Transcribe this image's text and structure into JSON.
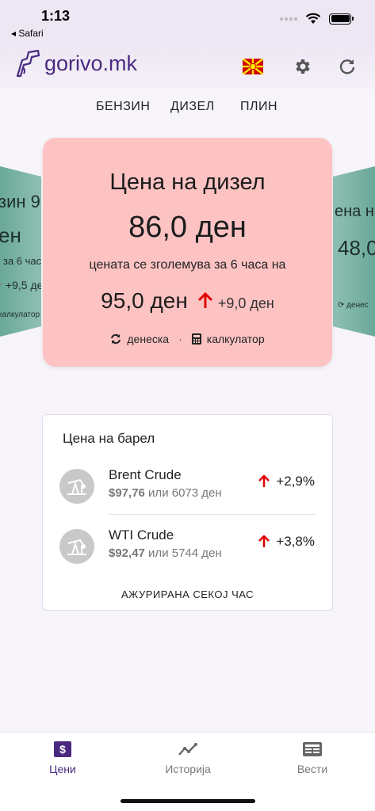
{
  "status": {
    "time": "1:13",
    "back_app": "◂ Safari"
  },
  "header": {
    "logo": "gorivo.mk"
  },
  "fuel_tabs": [
    "БЕНЗИН",
    "ДИЗЕЛ",
    "ПЛИН"
  ],
  "side_left": {
    "title": "зин 9",
    "price": "ен",
    "subtitle": "за 6 часа",
    "change": "+9,5 де",
    "link": "калкулатор"
  },
  "side_right": {
    "title": "ена н",
    "price": "48,0",
    "link": "денес"
  },
  "main_card": {
    "title": "Цена на дизел",
    "price": "86,0 ден",
    "subtitle": "цената се зголемува за 6 часа на",
    "future_price": "95,0 ден",
    "change": "+9,0 ден",
    "today_link": "денеска",
    "separator": "·",
    "calculator_link": "калкулатор"
  },
  "barrel": {
    "title": "Цена на барел",
    "items": [
      {
        "name": "Brent Crude",
        "usd": "$97,76",
        "joiner": " или ",
        "mkd": "6073 ден",
        "change": "+2,9%"
      },
      {
        "name": "WTI Crude",
        "usd": "$92,47",
        "joiner": " или ",
        "mkd": "5744 ден",
        "change": "+3,8%"
      }
    ],
    "update_note": "АЖУРИРАНА СЕКОЈ ЧАС"
  },
  "nav": [
    {
      "label": "Цени",
      "icon": "dollar-icon",
      "active": true
    },
    {
      "label": "Историја",
      "icon": "chart-line-icon",
      "active": false
    },
    {
      "label": "Вести",
      "icon": "news-icon",
      "active": false
    }
  ],
  "colors": {
    "accent": "#4a2a80",
    "card_bg": "#fdc3c3",
    "side_card": "#7bb3a6",
    "up_arrow": "#e00000"
  }
}
